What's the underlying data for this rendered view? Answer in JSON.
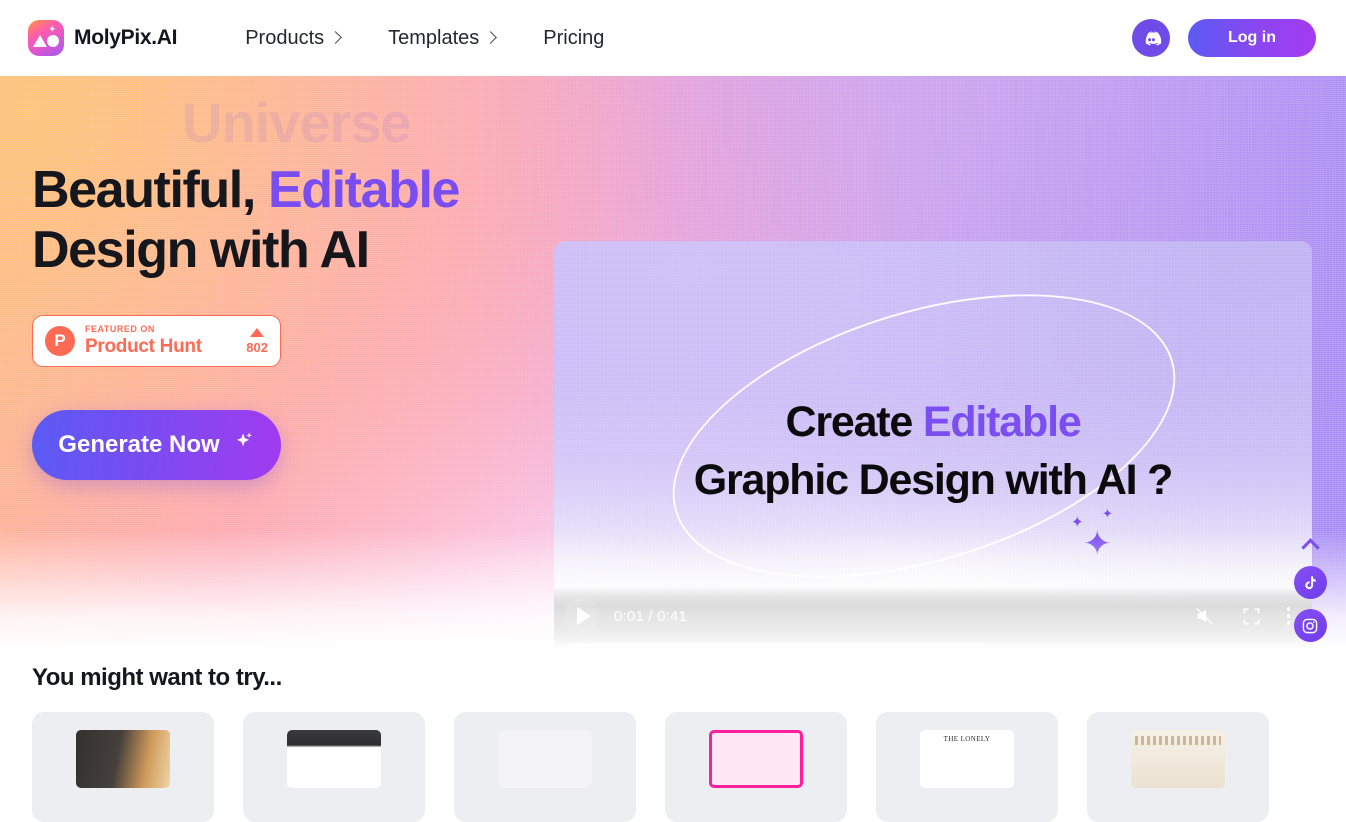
{
  "header": {
    "brand_name": "MolyPix.AI",
    "logo_icon": "molypix-logo-icon",
    "nav": [
      {
        "label": "Products",
        "has_chevron": true
      },
      {
        "label": "Templates",
        "has_chevron": true
      },
      {
        "label": "Pricing",
        "has_chevron": false
      }
    ],
    "discord_icon": "discord-icon",
    "login_label": "Log in"
  },
  "hero": {
    "ghost_text": "Universe",
    "heading_line1_plain": "Beautiful, ",
    "heading_line1_accent": "Editable",
    "heading_line2": "Design with AI",
    "product_hunt": {
      "logo_letter": "P",
      "eyebrow": "FEATURED ON",
      "name": "Product Hunt",
      "votes": "802"
    },
    "cta_label": "Generate Now",
    "cta_icon": "sparkle-icon"
  },
  "video": {
    "headline_line1_plain": "Create ",
    "headline_line1_accent": "Editable",
    "headline_line2": "Graphic Design with AI ?",
    "controls": {
      "play_icon": "play-icon",
      "time": "0:01 / 0:41",
      "mute_icon": "volume-muted-icon",
      "fullscreen_icon": "fullscreen-icon",
      "more_icon": "more-options-icon"
    }
  },
  "floating": {
    "scroll_top_icon": "chevron-up-icon",
    "tiktok_icon": "tiktok-icon",
    "instagram_icon": "instagram-icon"
  },
  "try_section": {
    "title": "You might want to try...",
    "cards": [
      {
        "name": "template-card-1"
      },
      {
        "name": "template-card-2"
      },
      {
        "name": "template-card-3"
      },
      {
        "name": "template-card-4"
      },
      {
        "name": "template-card-5"
      },
      {
        "name": "template-card-6"
      }
    ]
  },
  "colors": {
    "accent_purple": "#7a4df0",
    "brand_gradient_start": "#5b5bf5",
    "brand_gradient_end": "#a43bf0",
    "product_hunt_orange": "#ff6a55",
    "text_dark": "#15171d"
  }
}
